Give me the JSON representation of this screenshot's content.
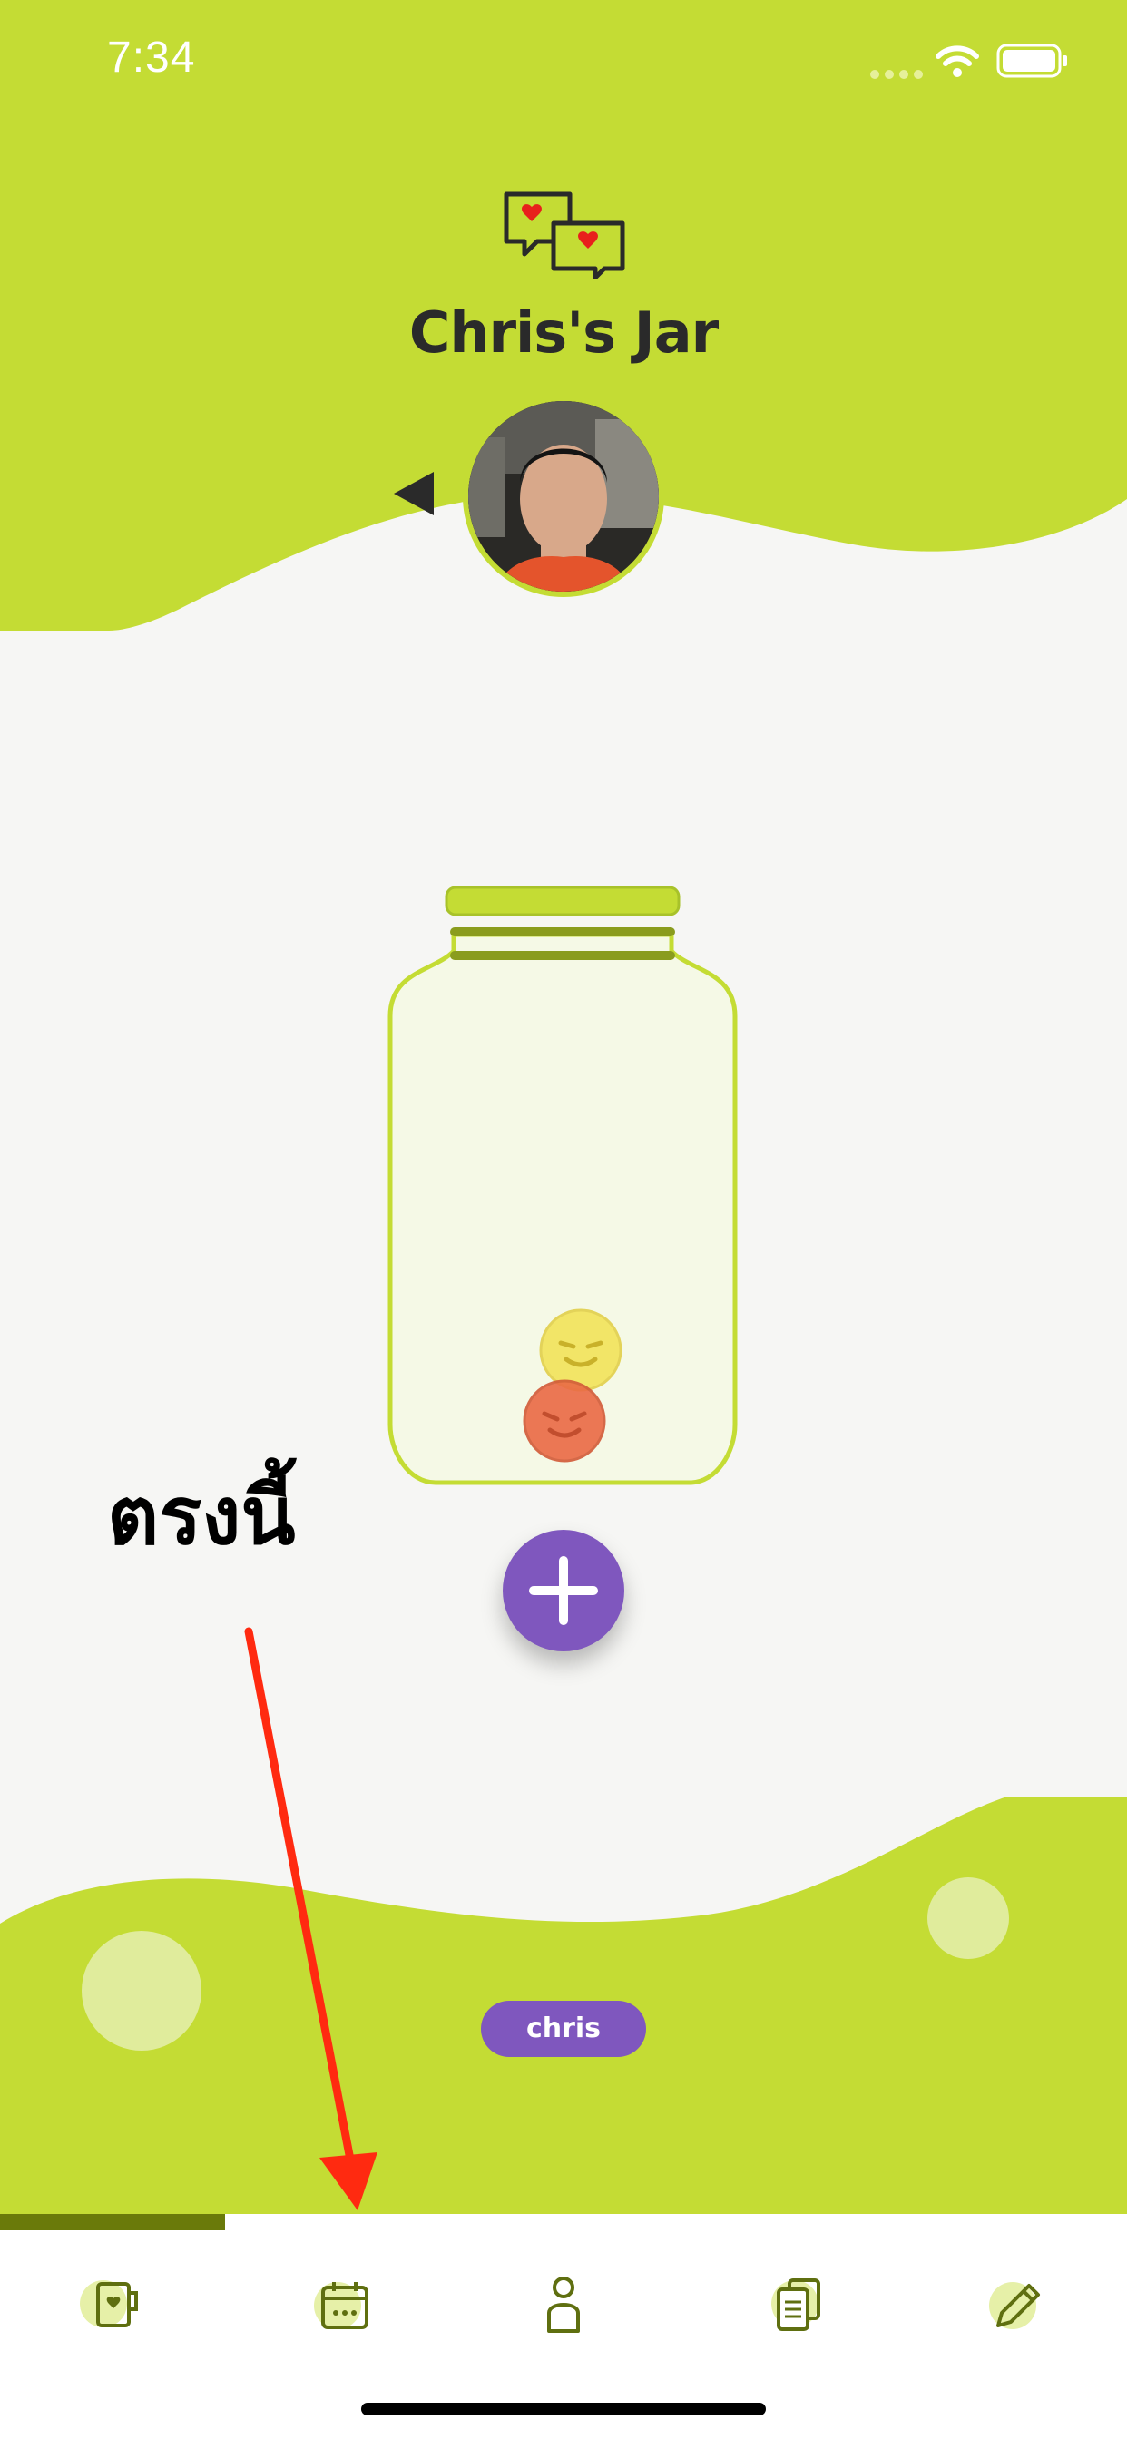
{
  "status_bar": {
    "time": "7:34",
    "signal_icon": "signal-dots-icon",
    "wifi_icon": "wifi-icon",
    "battery_icon": "battery-icon"
  },
  "header": {
    "logo_icon": "chat-hearts-icon",
    "title": "Chris's Jar",
    "back_icon": "left-triangle-icon"
  },
  "jar": {
    "emoji_tokens": [
      {
        "name": "yellow-smirk-token",
        "color": "#f2e35a"
      },
      {
        "name": "red-smirk-token",
        "color": "#ea6a45"
      }
    ]
  },
  "add_button": {
    "icon": "plus-icon"
  },
  "annotation": {
    "text": "ตรงนี้"
  },
  "footer": {
    "user_name": "chris"
  },
  "tab_bar": {
    "tabs": [
      {
        "name": "jar-tab",
        "icon": "mug-heart-icon",
        "active": true
      },
      {
        "name": "calendar-tab",
        "icon": "calendar-icon",
        "active": false
      },
      {
        "name": "profile-tab",
        "icon": "person-icon",
        "active": false
      },
      {
        "name": "documents-tab",
        "icon": "documents-icon",
        "active": false
      },
      {
        "name": "edit-tab",
        "icon": "pencil-icon",
        "active": false
      }
    ]
  },
  "colors": {
    "brand_green": "#c4dc34",
    "purple": "#7f57be",
    "background": "#f6f6f4",
    "arrow_red": "#ff2a10"
  }
}
